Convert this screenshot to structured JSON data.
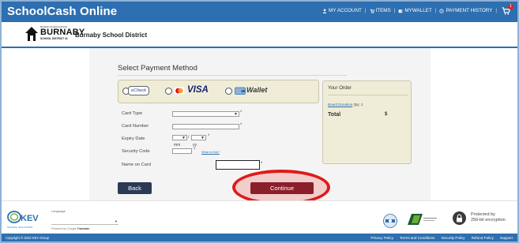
{
  "app": {
    "title": "SchoolCash Online"
  },
  "topnav": {
    "my_account": "MY ACCOUNT",
    "items": "ITEMS",
    "mywallet": "MYWALLET",
    "payment_history": "PAYMENT HISTORY",
    "cart_count": "1"
  },
  "district": {
    "logo_small": "BOARD OF EDUCATION",
    "logo_big": "BURNABY",
    "logo_sub": "SCHOOL DISTRICT 41",
    "name": "Burnaby School District"
  },
  "payment": {
    "heading": "Select Payment Method",
    "echeck_label": "eCheck",
    "visa_label": "VISA",
    "wallet_label": "Wallet"
  },
  "form": {
    "card_type_label": "Card Type",
    "card_number_label": "Card Number",
    "expiry_label": "Expiry Date",
    "expiry_month": "mm",
    "expiry_year": "yy",
    "expiry_sep": "/",
    "security_label": "Security Code",
    "whats_this": "What is this?",
    "name_label": "Name on Card",
    "required_mark": "*"
  },
  "order": {
    "title": "Your Order",
    "item_name": "Board Donation",
    "item_qty": "Qty: 1",
    "total_label": "Total",
    "currency": "$"
  },
  "buttons": {
    "back": "Back",
    "continue": "Continue"
  },
  "footer": {
    "kev_sub": "SCHOOL SOLUTIONS",
    "language_label": "Language",
    "powered_by": "Powered by",
    "translate_brand": "Google",
    "translate_word": "Translate",
    "secure_line1": "Protected by",
    "secure_line2": "256-bit encryption",
    "copyright": "Copyright © 2022 KEV Group",
    "links": [
      "Privacy Policy",
      "Terms and Conditions",
      "Security Policy",
      "Refund Policy",
      "Support"
    ]
  },
  "colors": {
    "brand_blue": "#2d6fb0",
    "continue_red": "#8a1f2b",
    "back_navy": "#2b3a55",
    "highlight": "#e01a1a"
  },
  "icons": [
    "user-icon",
    "cart-icon",
    "wallet-icon",
    "clock-icon",
    "shopping-cart-icon",
    "lock-icon"
  ]
}
